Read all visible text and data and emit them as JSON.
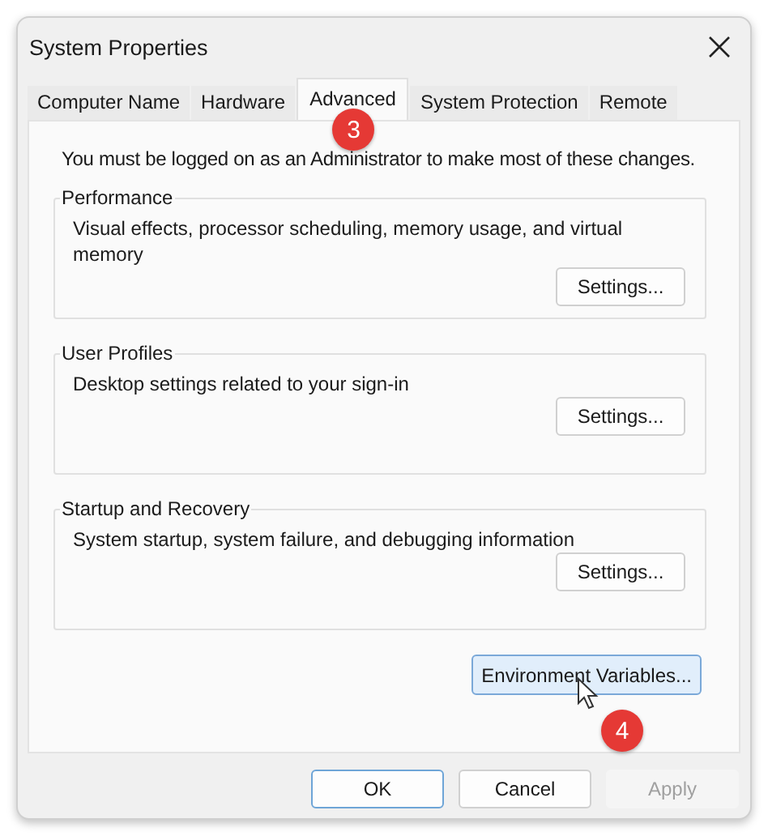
{
  "window": {
    "title": "System Properties"
  },
  "tabs": [
    {
      "label": "Computer Name",
      "selected": false
    },
    {
      "label": "Hardware",
      "selected": false
    },
    {
      "label": "Advanced",
      "selected": true,
      "callout": "3"
    },
    {
      "label": "System Protection",
      "selected": false
    },
    {
      "label": "Remote",
      "selected": false
    }
  ],
  "admin_note": "You must be logged on as an Administrator to make most of these changes.",
  "groups": [
    {
      "title": "Performance",
      "description": "Visual effects, processor scheduling, memory usage, and virtual memory",
      "button": "Settings..."
    },
    {
      "title": "User Profiles",
      "description": "Desktop settings related to your sign-in",
      "button": "Settings..."
    },
    {
      "title": "Startup and Recovery",
      "description": "System startup, system failure, and debugging information",
      "button": "Settings..."
    }
  ],
  "environment_button": {
    "label": "Environment Variables...",
    "hovered": true,
    "callout": "4"
  },
  "buttons": [
    {
      "label": "OK",
      "kind": "default"
    },
    {
      "label": "Cancel",
      "kind": "normal"
    },
    {
      "label": "Apply",
      "kind": "disabled"
    }
  ]
}
